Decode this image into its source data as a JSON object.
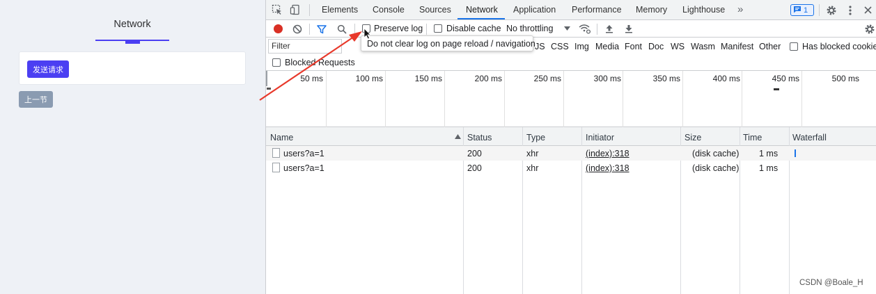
{
  "demo": {
    "title": "Network",
    "send_button": "发送请求",
    "prev_button": "上一节"
  },
  "devtools": {
    "tabs": [
      "Elements",
      "Console",
      "Sources",
      "Network",
      "Application",
      "Performance",
      "Memory",
      "Lighthouse"
    ],
    "active_tab": "Network",
    "more_tabs": "»",
    "issues_count": "1",
    "toolbar": {
      "preserve_log": "Preserve log",
      "disable_cache": "Disable cache",
      "throttling": "No throttling"
    },
    "filter": {
      "placeholder": "Filter",
      "types_visible": [
        "JS",
        "CSS",
        "Img",
        "Media",
        "Font",
        "Doc",
        "WS",
        "Wasm",
        "Manifest",
        "Other"
      ],
      "has_blocked_cookies": "Has blocked cookies",
      "blocked_requests": "Blocked Requests"
    },
    "tooltip": "Do not clear log on page reload / navigation",
    "timeline_ticks": [
      "50 ms",
      "100 ms",
      "150 ms",
      "200 ms",
      "250 ms",
      "300 ms",
      "350 ms",
      "400 ms",
      "450 ms",
      "500 ms"
    ],
    "columns": [
      "Name",
      "Status",
      "Type",
      "Initiator",
      "Size",
      "Time",
      "Waterfall"
    ],
    "requests": [
      {
        "name": "users?a=1",
        "status": "200",
        "type": "xhr",
        "initiator": "(index):318",
        "size": "(disk cache)",
        "time": "1 ms"
      },
      {
        "name": "users?a=1",
        "status": "200",
        "type": "xhr",
        "initiator": "(index):318",
        "size": "(disk cache)",
        "time": "1 ms"
      }
    ]
  },
  "watermark": "CSDN @Boale_H",
  "colors": {
    "accent": "#4b3ff2",
    "devtools_blue": "#1a73e8",
    "record_red": "#d93025",
    "annotation_arrow": "#e8392b"
  }
}
